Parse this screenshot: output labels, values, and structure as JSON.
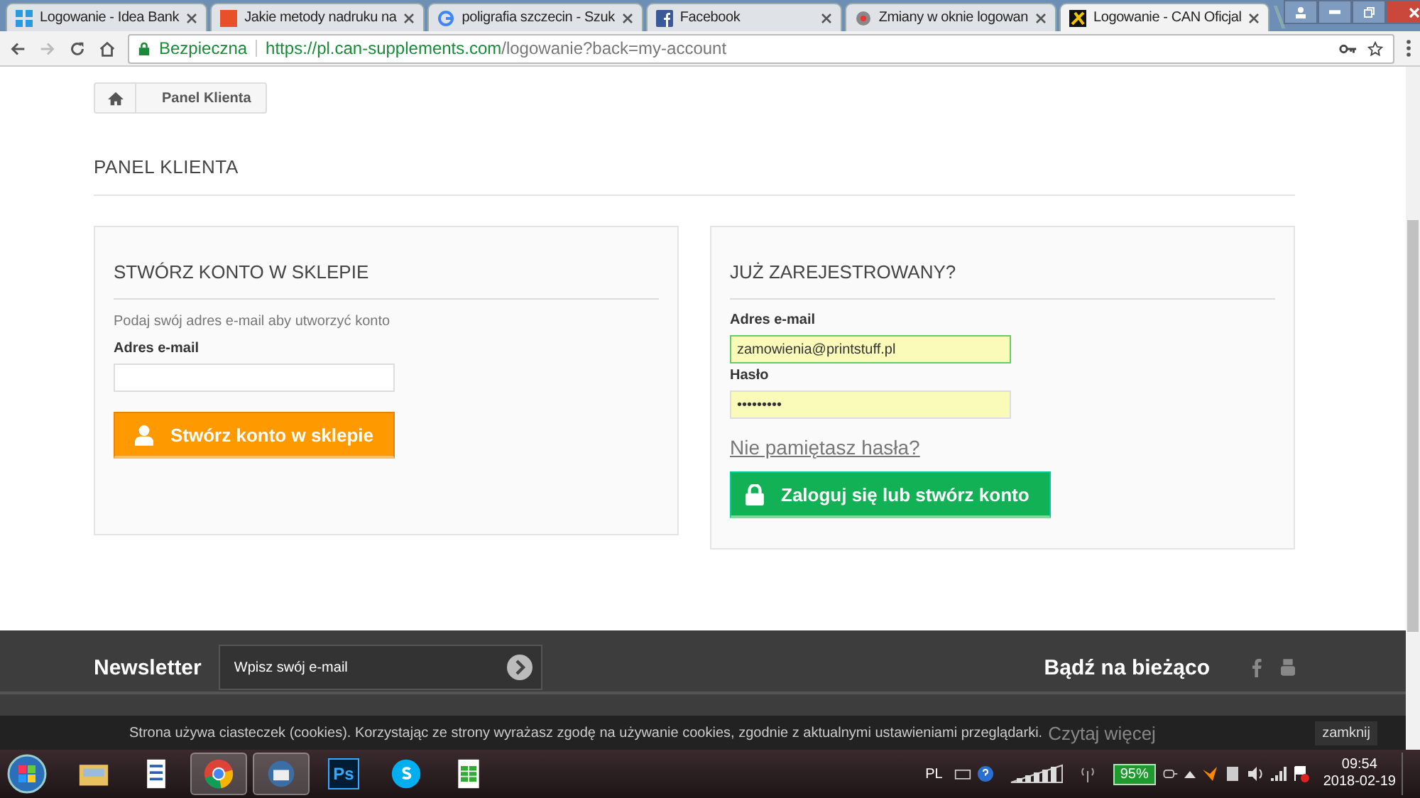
{
  "browser": {
    "tabs": [
      {
        "title": "Logowanie - Idea Bank",
        "selected": false
      },
      {
        "title": "Jakie metody nadruku na",
        "selected": false
      },
      {
        "title": "poligrafia szczecin - Szuk",
        "selected": false
      },
      {
        "title": "Facebook",
        "selected": false
      },
      {
        "title": "Zmiany w oknie logowan",
        "selected": false
      },
      {
        "title": "Logowanie - CAN Oficjal",
        "selected": true
      }
    ],
    "security": "Bezpieczna",
    "url_host": "https://pl.can-supplements.com",
    "url_path": "/logowanie?back=my-account"
  },
  "breadcrumb": {
    "current": "Panel Klienta"
  },
  "page_title": "PANEL KLIENTA",
  "create_account": {
    "title": "STWÓRZ KONTO W SKLEPIE",
    "hint": "Podaj swój adres e-mail aby utworzyć konto",
    "email_label": "Adres e-mail",
    "button": "Stwórz konto w sklepie"
  },
  "login": {
    "title": "JUŻ ZAREJESTROWANY?",
    "email_label": "Adres e-mail",
    "email_value": "zamowienia@printstuff.pl",
    "password_label": "Hasło",
    "password_value": "•••••••••",
    "forgot_link": "Nie pamiętasz hasła?",
    "button": "Zaloguj się lub stwórz konto"
  },
  "footer": {
    "newsletter_title": "Newsletter",
    "newsletter_placeholder": "Wpisz swój e-mail",
    "social_title": "Bądź na bieżąco"
  },
  "cookie_bar": {
    "text": "Strona używa ciasteczek (cookies). Korzystając ze strony wyrażasz zgodę na używanie cookies, zgodnie z aktualnymi ustawieniami przeglądarki.",
    "more_link": "Czytaj więcej",
    "close_button": "zamknij"
  },
  "taskbar": {
    "app_badge": "Ps",
    "language": "PL",
    "battery": "95%",
    "time": "09:54",
    "date": "2018-02-19"
  }
}
